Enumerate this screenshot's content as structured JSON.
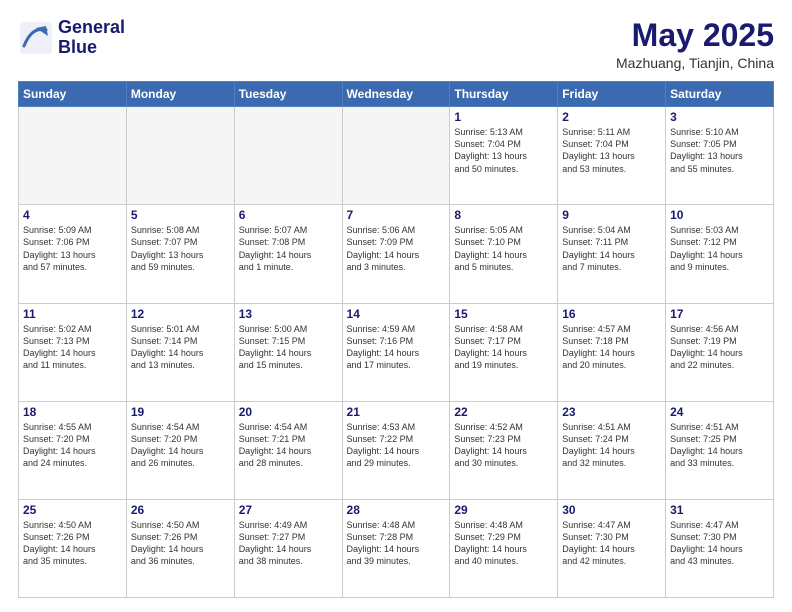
{
  "header": {
    "logo_line1": "General",
    "logo_line2": "Blue",
    "month": "May 2025",
    "location": "Mazhuang, Tianjin, China"
  },
  "weekdays": [
    "Sunday",
    "Monday",
    "Tuesday",
    "Wednesday",
    "Thursday",
    "Friday",
    "Saturday"
  ],
  "weeks": [
    [
      {
        "day": "",
        "info": ""
      },
      {
        "day": "",
        "info": ""
      },
      {
        "day": "",
        "info": ""
      },
      {
        "day": "",
        "info": ""
      },
      {
        "day": "1",
        "info": "Sunrise: 5:13 AM\nSunset: 7:04 PM\nDaylight: 13 hours\nand 50 minutes."
      },
      {
        "day": "2",
        "info": "Sunrise: 5:11 AM\nSunset: 7:04 PM\nDaylight: 13 hours\nand 53 minutes."
      },
      {
        "day": "3",
        "info": "Sunrise: 5:10 AM\nSunset: 7:05 PM\nDaylight: 13 hours\nand 55 minutes."
      }
    ],
    [
      {
        "day": "4",
        "info": "Sunrise: 5:09 AM\nSunset: 7:06 PM\nDaylight: 13 hours\nand 57 minutes."
      },
      {
        "day": "5",
        "info": "Sunrise: 5:08 AM\nSunset: 7:07 PM\nDaylight: 13 hours\nand 59 minutes."
      },
      {
        "day": "6",
        "info": "Sunrise: 5:07 AM\nSunset: 7:08 PM\nDaylight: 14 hours\nand 1 minute."
      },
      {
        "day": "7",
        "info": "Sunrise: 5:06 AM\nSunset: 7:09 PM\nDaylight: 14 hours\nand 3 minutes."
      },
      {
        "day": "8",
        "info": "Sunrise: 5:05 AM\nSunset: 7:10 PM\nDaylight: 14 hours\nand 5 minutes."
      },
      {
        "day": "9",
        "info": "Sunrise: 5:04 AM\nSunset: 7:11 PM\nDaylight: 14 hours\nand 7 minutes."
      },
      {
        "day": "10",
        "info": "Sunrise: 5:03 AM\nSunset: 7:12 PM\nDaylight: 14 hours\nand 9 minutes."
      }
    ],
    [
      {
        "day": "11",
        "info": "Sunrise: 5:02 AM\nSunset: 7:13 PM\nDaylight: 14 hours\nand 11 minutes."
      },
      {
        "day": "12",
        "info": "Sunrise: 5:01 AM\nSunset: 7:14 PM\nDaylight: 14 hours\nand 13 minutes."
      },
      {
        "day": "13",
        "info": "Sunrise: 5:00 AM\nSunset: 7:15 PM\nDaylight: 14 hours\nand 15 minutes."
      },
      {
        "day": "14",
        "info": "Sunrise: 4:59 AM\nSunset: 7:16 PM\nDaylight: 14 hours\nand 17 minutes."
      },
      {
        "day": "15",
        "info": "Sunrise: 4:58 AM\nSunset: 7:17 PM\nDaylight: 14 hours\nand 19 minutes."
      },
      {
        "day": "16",
        "info": "Sunrise: 4:57 AM\nSunset: 7:18 PM\nDaylight: 14 hours\nand 20 minutes."
      },
      {
        "day": "17",
        "info": "Sunrise: 4:56 AM\nSunset: 7:19 PM\nDaylight: 14 hours\nand 22 minutes."
      }
    ],
    [
      {
        "day": "18",
        "info": "Sunrise: 4:55 AM\nSunset: 7:20 PM\nDaylight: 14 hours\nand 24 minutes."
      },
      {
        "day": "19",
        "info": "Sunrise: 4:54 AM\nSunset: 7:20 PM\nDaylight: 14 hours\nand 26 minutes."
      },
      {
        "day": "20",
        "info": "Sunrise: 4:54 AM\nSunset: 7:21 PM\nDaylight: 14 hours\nand 28 minutes."
      },
      {
        "day": "21",
        "info": "Sunrise: 4:53 AM\nSunset: 7:22 PM\nDaylight: 14 hours\nand 29 minutes."
      },
      {
        "day": "22",
        "info": "Sunrise: 4:52 AM\nSunset: 7:23 PM\nDaylight: 14 hours\nand 30 minutes."
      },
      {
        "day": "23",
        "info": "Sunrise: 4:51 AM\nSunset: 7:24 PM\nDaylight: 14 hours\nand 32 minutes."
      },
      {
        "day": "24",
        "info": "Sunrise: 4:51 AM\nSunset: 7:25 PM\nDaylight: 14 hours\nand 33 minutes."
      }
    ],
    [
      {
        "day": "25",
        "info": "Sunrise: 4:50 AM\nSunset: 7:26 PM\nDaylight: 14 hours\nand 35 minutes."
      },
      {
        "day": "26",
        "info": "Sunrise: 4:50 AM\nSunset: 7:26 PM\nDaylight: 14 hours\nand 36 minutes."
      },
      {
        "day": "27",
        "info": "Sunrise: 4:49 AM\nSunset: 7:27 PM\nDaylight: 14 hours\nand 38 minutes."
      },
      {
        "day": "28",
        "info": "Sunrise: 4:48 AM\nSunset: 7:28 PM\nDaylight: 14 hours\nand 39 minutes."
      },
      {
        "day": "29",
        "info": "Sunrise: 4:48 AM\nSunset: 7:29 PM\nDaylight: 14 hours\nand 40 minutes."
      },
      {
        "day": "30",
        "info": "Sunrise: 4:47 AM\nSunset: 7:30 PM\nDaylight: 14 hours\nand 42 minutes."
      },
      {
        "day": "31",
        "info": "Sunrise: 4:47 AM\nSunset: 7:30 PM\nDaylight: 14 hours\nand 43 minutes."
      }
    ]
  ]
}
